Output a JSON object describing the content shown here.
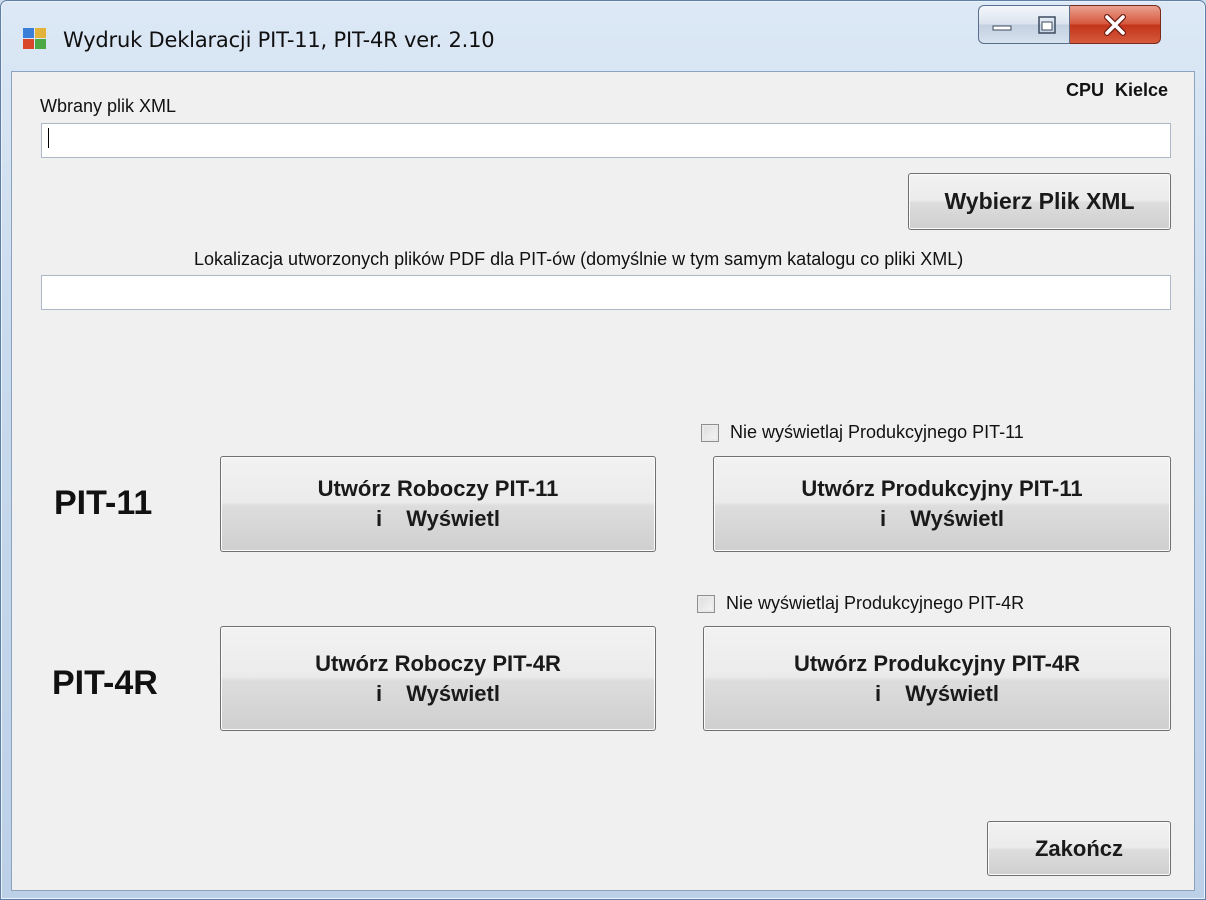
{
  "window": {
    "title": "Wydruk Deklaracji PIT-11, PIT-4R  ver. 2.10",
    "colors": {
      "frame": "#c9daee",
      "client": "#f0f0f0",
      "close": "#c3351b"
    }
  },
  "header": {
    "company": "CPU  Kielce"
  },
  "xml_file": {
    "label": "Wbrany plik XML",
    "value": "",
    "choose_button": "Wybierz Plik XML"
  },
  "pdf_location": {
    "label": "Lokalizacja utworzonych plików PDF dla PIT-ów (domyślnie w tym samym katalogu co pliki XML)",
    "value": ""
  },
  "pit11": {
    "label": "PIT-11",
    "checkbox_label": "Nie wyświetlaj Produkcyjnego PIT-11",
    "checked": false,
    "draft_button": {
      "line1": "Utwórz Roboczy PIT-11",
      "line2": "i Wyświetl"
    },
    "production_button": {
      "line1": "Utwórz Produkcyjny PIT-11",
      "line2": "i Wyświetl"
    }
  },
  "pit4r": {
    "label": "PIT-4R",
    "checkbox_label": "Nie wyświetlaj Produkcyjnego PIT-4R",
    "checked": false,
    "draft_button": {
      "line1": "Utwórz Roboczy PIT-4R",
      "line2": "i Wyświetl"
    },
    "production_button": {
      "line1": "Utwórz Produkcyjny PIT-4R",
      "line2": "i Wyświetl"
    }
  },
  "footer": {
    "exit_button": "Zakończ"
  },
  "icons": [
    "app-icon",
    "minimize-icon",
    "maximize-icon",
    "close-icon"
  ]
}
